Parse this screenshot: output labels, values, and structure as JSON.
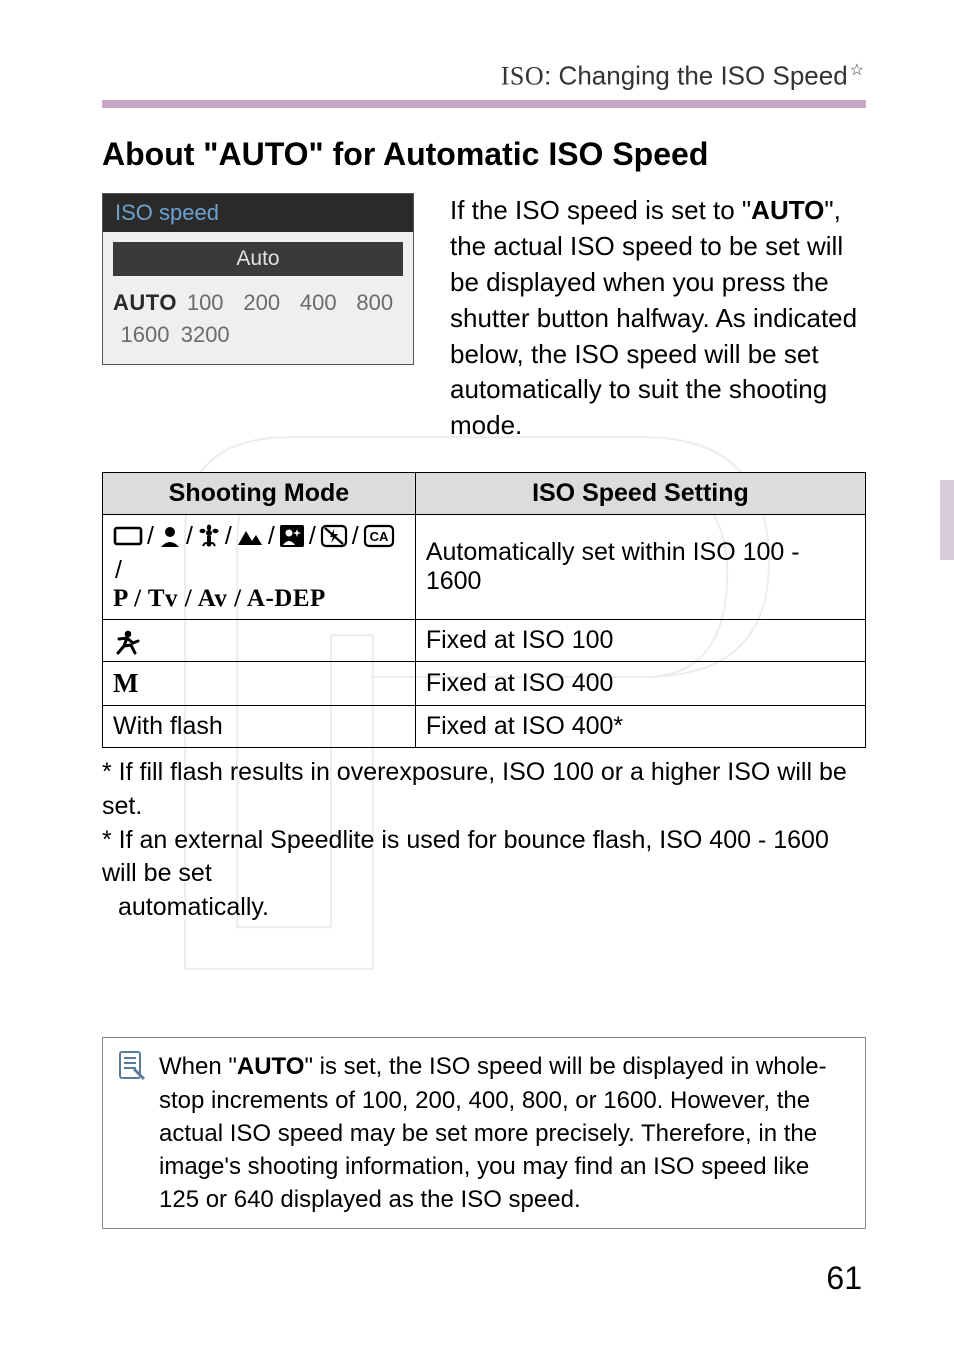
{
  "header": {
    "prefix": "ISO",
    "title": ": Changing the ISO Speed",
    "star": "☆"
  },
  "section_title": "About \"AUTO\" for Automatic ISO Speed",
  "lcd": {
    "title": "ISO speed",
    "bar": "Auto",
    "options": [
      "AUTO",
      "100",
      "200",
      "400",
      "800",
      "1600",
      "3200"
    ],
    "selected_index": 0
  },
  "paragraph": {
    "pre": "If the ISO speed is set to \"",
    "bold": "AUTO",
    "post": "\", the actual ISO speed to be set will be displayed when you press the shutter button halfway. As indicated below, the ISO speed will be set automatically to suit the shooting mode."
  },
  "table": {
    "head": [
      "Shooting Mode",
      "ISO Speed Setting"
    ],
    "rows": [
      {
        "mode_text_line2": "P / Tv / Av / A-DEP",
        "setting": "Automatically set within ISO 100 - 1600"
      },
      {
        "setting": "Fixed at ISO 100"
      },
      {
        "m_label": "M",
        "setting": "Fixed at ISO 400"
      },
      {
        "label": "With flash",
        "setting": "Fixed at ISO 400*"
      }
    ]
  },
  "footnotes": {
    "l1": "* If fill flash results in overexposure, ISO 100 or a higher ISO will be set.",
    "l2": "* If an external Speedlite is used for bounce flash, ISO 400 - 1600 will be set",
    "l3": "automatically."
  },
  "note": {
    "pre": "When \"",
    "bold": "AUTO",
    "post": "\" is set, the ISO speed will be displayed in whole-stop increments of 100, 200, 400, 800, or 1600. However, the actual ISO speed may be set more precisely. Therefore, in the image's shooting information, you may find an ISO speed like 125 or 640 displayed as the ISO speed."
  },
  "page_number": "61"
}
